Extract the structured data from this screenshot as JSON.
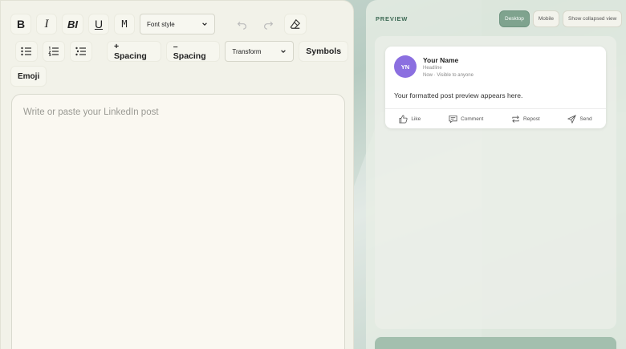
{
  "toolbar": {
    "bold": "B",
    "italic": "I",
    "bold_italic": "BI",
    "underline": "U",
    "monospace": "M",
    "font_style": "Font style",
    "add_spacing": "+ Spacing",
    "remove_spacing": "– Spacing",
    "transform": "Transform",
    "symbols": "Symbols",
    "emoji": "Emoji"
  },
  "editor": {
    "placeholder": "Write or paste your LinkedIn post"
  },
  "preview": {
    "title": "PREVIEW",
    "tabs": [
      "Desktop",
      "Mobile",
      "Show collapsed view"
    ],
    "active_tab": "Desktop",
    "card": {
      "avatar_initials": "YN",
      "name": "Your Name",
      "headline": "Headline",
      "time": "Now · Visible to anyone",
      "text": "Your formatted post preview appears here.",
      "actions": [
        "Like",
        "Comment",
        "Repost",
        "Send"
      ]
    }
  },
  "colors": {
    "accent": "#7fa38e",
    "avatar": "#8b6fe0",
    "preview_title": "#3d6a55"
  }
}
